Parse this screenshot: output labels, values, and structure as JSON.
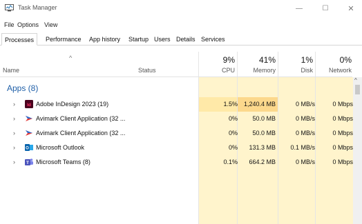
{
  "window": {
    "title": "Task Manager",
    "minimize_glyph": "—",
    "maximize_glyph": "☐",
    "close_glyph": "✕"
  },
  "menu": [
    "File",
    "Options",
    "View"
  ],
  "tabs": [
    {
      "label": "Processes",
      "active": true
    },
    {
      "label": "Performance"
    },
    {
      "label": "App history"
    },
    {
      "label": "Startup"
    },
    {
      "label": "Users"
    },
    {
      "label": "Details"
    },
    {
      "label": "Services"
    }
  ],
  "columns": {
    "name": "Name",
    "status": "Status",
    "cpu": {
      "percent": "9%",
      "label": "CPU"
    },
    "memory": {
      "percent": "41%",
      "label": "Memory"
    },
    "disk": {
      "percent": "1%",
      "label": "Disk"
    },
    "network": {
      "percent": "0%",
      "label": "Network"
    }
  },
  "group": {
    "label": "Apps (8)"
  },
  "processes": [
    {
      "name": "Adobe InDesign 2023 (19)",
      "icon": "indesign-icon",
      "cpu": "1.5%",
      "memory": "1,240.4 MB",
      "disk": "0 MB/s",
      "network": "0 Mbps"
    },
    {
      "name": "Avimark Client Application (32 ...",
      "icon": "avimark-icon",
      "cpu": "0%",
      "memory": "50.0 MB",
      "disk": "0 MB/s",
      "network": "0 Mbps"
    },
    {
      "name": "Avimark Client Application (32 ...",
      "icon": "avimark-icon",
      "cpu": "0%",
      "memory": "50.0 MB",
      "disk": "0 MB/s",
      "network": "0 Mbps"
    },
    {
      "name": "Microsoft Outlook",
      "icon": "outlook-icon",
      "cpu": "0%",
      "memory": "131.3 MB",
      "disk": "0.1 MB/s",
      "network": "0 Mbps"
    },
    {
      "name": "Microsoft Teams (8)",
      "icon": "teams-icon",
      "cpu": "0.1%",
      "memory": "664.2 MB",
      "disk": "0 MB/s",
      "network": "0 Mbps"
    }
  ],
  "colors": {
    "heat_light": "#fff4cc",
    "heat_medium": "#ffe9a8",
    "heat_strong": "#fcd88c",
    "group_label": "#1f5fa8"
  }
}
